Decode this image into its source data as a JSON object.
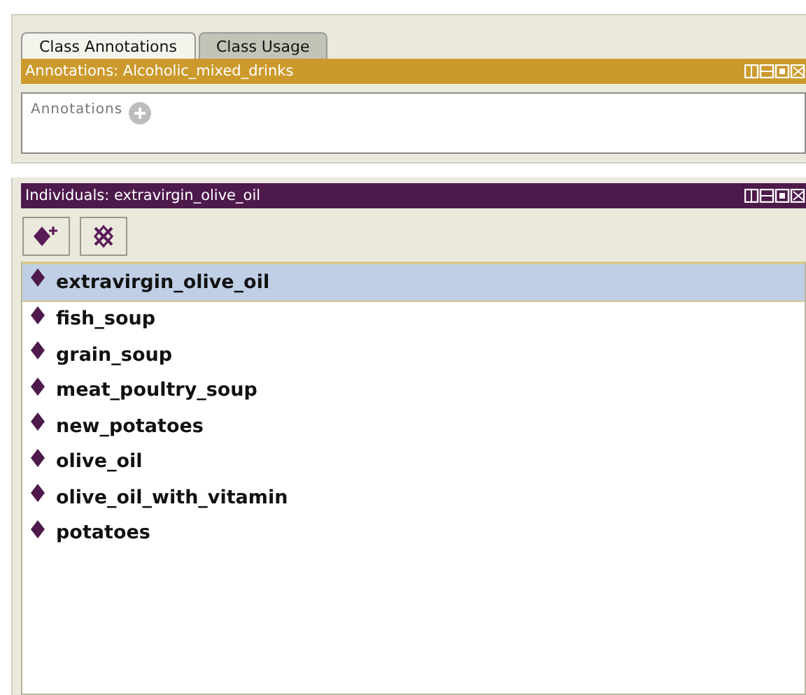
{
  "tabs": [
    {
      "label": "Class Annotations",
      "selected": true
    },
    {
      "label": "Class Usage",
      "selected": false
    }
  ],
  "annotations_panel": {
    "title": "Annotations: Alcoholic_mixed_drinks",
    "label": "Annotations"
  },
  "individuals_panel": {
    "title": "Individuals: extravirgin_olive_oil",
    "items": [
      {
        "label": "extravirgin_olive_oil",
        "selected": true
      },
      {
        "label": "fish_soup",
        "selected": false
      },
      {
        "label": "grain_soup",
        "selected": false
      },
      {
        "label": "meat_poultry_soup",
        "selected": false
      },
      {
        "label": "new_potatoes",
        "selected": false
      },
      {
        "label": "olive_oil",
        "selected": false
      },
      {
        "label": "olive_oil_with_vitamin",
        "selected": false
      },
      {
        "label": "potatoes",
        "selected": false
      }
    ]
  }
}
